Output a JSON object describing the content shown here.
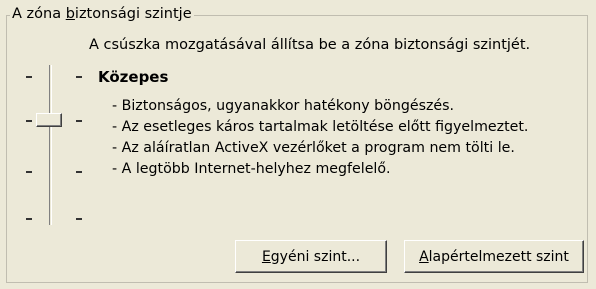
{
  "groupbox": {
    "legend_prefix": "A zóna ",
    "legend_access_key": "b",
    "legend_suffix": "iztonsági szintje"
  },
  "instruction": "A csúszka mozgatásával állítsa be a zóna biztonsági szintjét.",
  "level": {
    "title": "Közepes",
    "descriptions": [
      "- Biztonságos, ugyanakkor hatékony böngészés.",
      "- Az esetleges káros tartalmak letöltése előtt figyelmeztet.",
      "- Az aláíratlan ActiveX vezérlőket a program nem tölti le.",
      "- A legtöbb Internet-helyhez megfelelő."
    ]
  },
  "slider": {
    "levels_count": 4,
    "selected_index": 1,
    "selected_label": "Közepes"
  },
  "buttons": {
    "custom": {
      "access_key": "E",
      "rest": "gyéni szint..."
    },
    "default": {
      "access_key": "A",
      "rest": "lapértelmezett szint"
    }
  }
}
